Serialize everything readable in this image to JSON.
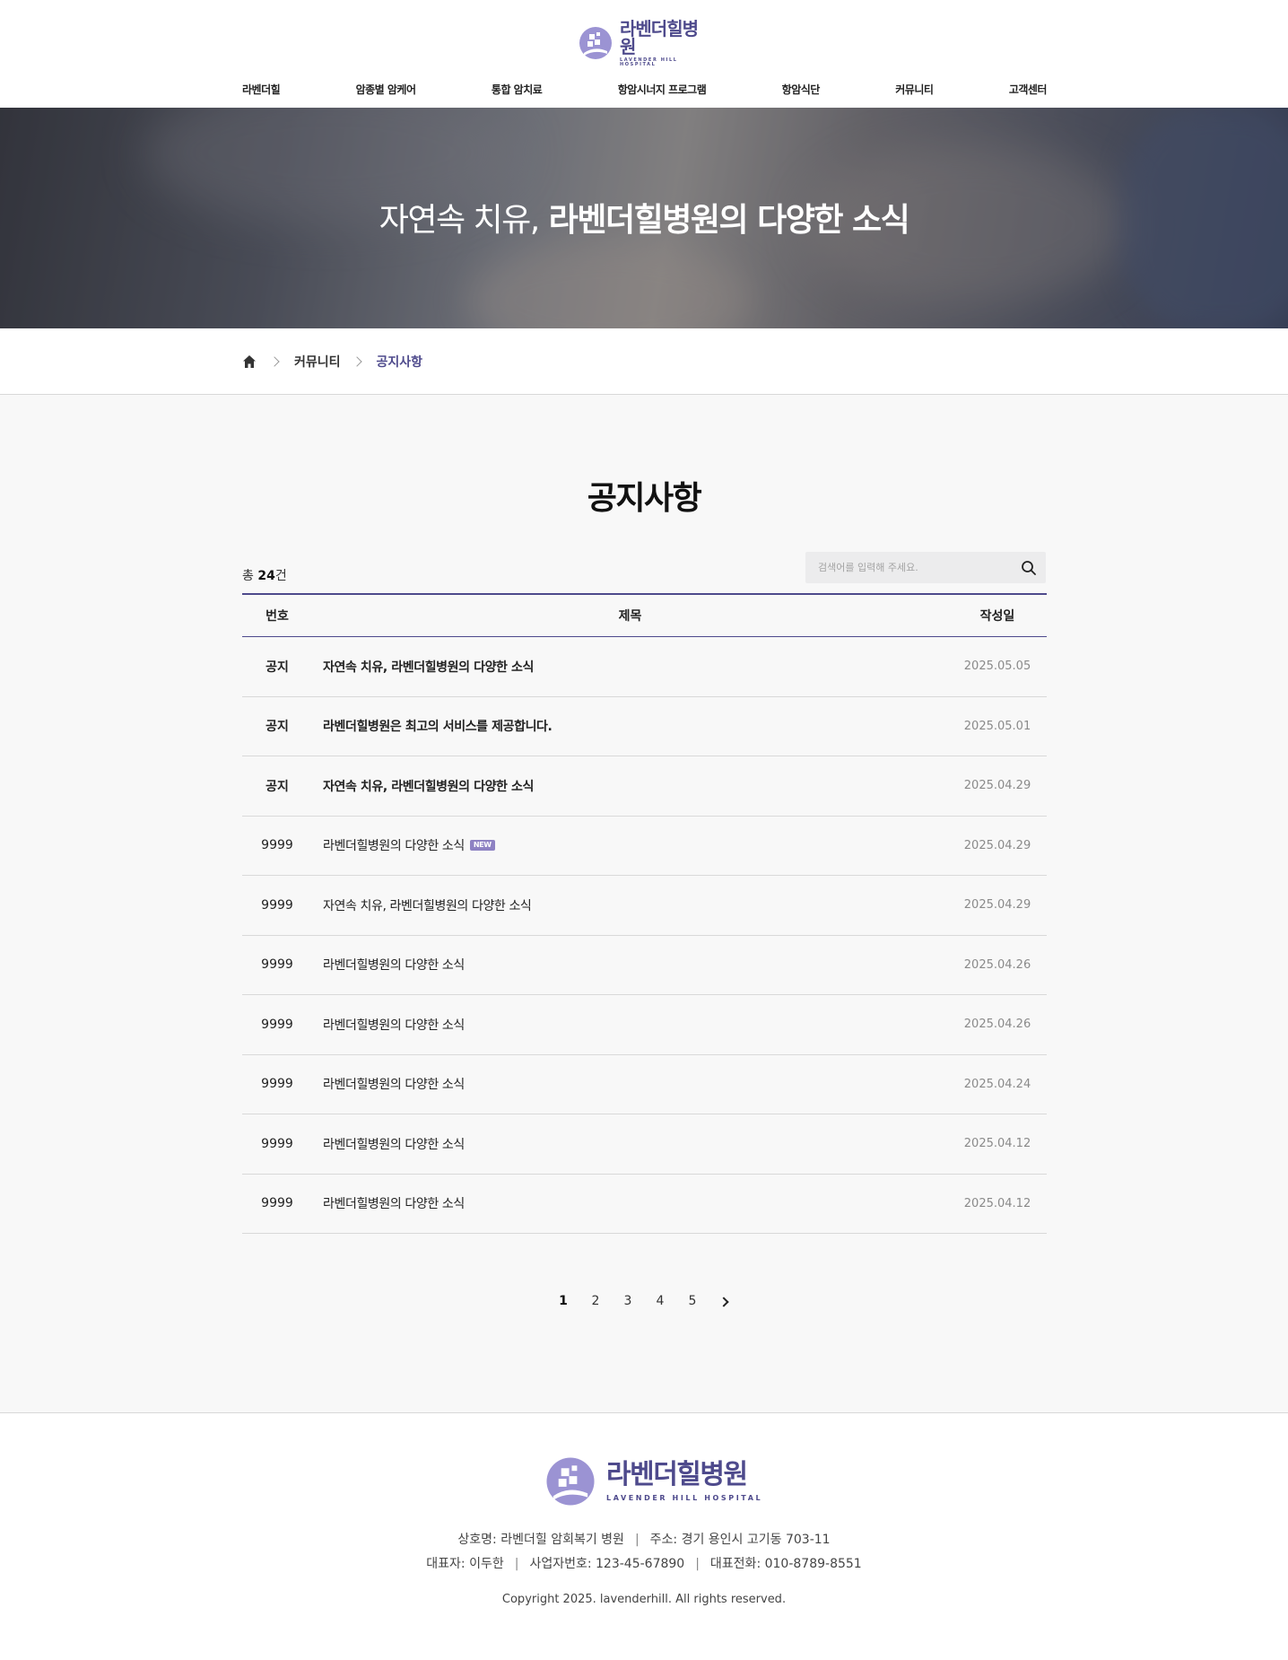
{
  "header": {
    "logo_ko": "라벤더힐병원",
    "logo_en": "LAVENDER HILL HOSPITAL",
    "nav": [
      "라벤더힐",
      "암종별 암케어",
      "통합 암치료",
      "항암시너지 프로그램",
      "항암식단",
      "커뮤니티",
      "고객센터"
    ]
  },
  "hero": {
    "title_light": "자연속 치유,",
    "title_bold": "라벤더힐병원의 다양한 소식"
  },
  "breadcrumb": {
    "items": [
      "커뮤니티",
      "공지사항"
    ]
  },
  "board": {
    "title": "공지사항",
    "total_prefix": "총 ",
    "total_count": "24",
    "total_suffix": "건",
    "search_placeholder": "검색어를 입력해 주세요.",
    "columns": {
      "num": "번호",
      "title": "제목",
      "date": "작성일"
    },
    "rows": [
      {
        "num": "공지",
        "title": "자연속 치유, 라벤더힐병원의 다양한 소식",
        "date": "2025.05.05",
        "notice": true,
        "badge": ""
      },
      {
        "num": "공지",
        "title": "라벤더힐병원은 최고의 서비스를 제공합니다.",
        "date": "2025.05.01",
        "notice": true,
        "badge": ""
      },
      {
        "num": "공지",
        "title": "자연속 치유, 라벤더힐병원의 다양한 소식",
        "date": "2025.04.29",
        "notice": true,
        "badge": ""
      },
      {
        "num": "9999",
        "title": "라벤더힐병원의 다양한 소식",
        "date": "2025.04.29",
        "notice": false,
        "badge": "NEW"
      },
      {
        "num": "9999",
        "title": "자연속 치유, 라벤더힐병원의 다양한 소식",
        "date": "2025.04.29",
        "notice": false,
        "badge": ""
      },
      {
        "num": "9999",
        "title": "라벤더힐병원의 다양한 소식",
        "date": "2025.04.26",
        "notice": false,
        "badge": ""
      },
      {
        "num": "9999",
        "title": "라벤더힐병원의 다양한 소식",
        "date": "2025.04.26",
        "notice": false,
        "badge": ""
      },
      {
        "num": "9999",
        "title": "라벤더힐병원의 다양한 소식",
        "date": "2025.04.24",
        "notice": false,
        "badge": ""
      },
      {
        "num": "9999",
        "title": "라벤더힐병원의 다양한 소식",
        "date": "2025.04.12",
        "notice": false,
        "badge": ""
      },
      {
        "num": "9999",
        "title": "라벤더힐병원의 다양한 소식",
        "date": "2025.04.12",
        "notice": false,
        "badge": ""
      }
    ]
  },
  "pagination": {
    "pages": [
      "1",
      "2",
      "3",
      "4",
      "5"
    ],
    "active": "1",
    "next_icon": "chevron-right-icon"
  },
  "footer": {
    "logo_ko": "라벤더힐병원",
    "logo_en": "LAVENDER HILL HOSPITAL",
    "company": "상호명: 라벤더힐 암회복기 병원",
    "address": "주소: 경기 용인시 고기동 703-11",
    "ceo": "대표자: 이두한",
    "biz_no": "사업자번호: 123-45-67890",
    "phone": "대표전화: 010-8789-8551",
    "copyright": "Copyright 2025. lavenderhill. All rights reserved."
  },
  "colors": {
    "brand": "#4e4a8c",
    "logo_lavender": "#9b93d3",
    "badge": "#8e82c3"
  }
}
